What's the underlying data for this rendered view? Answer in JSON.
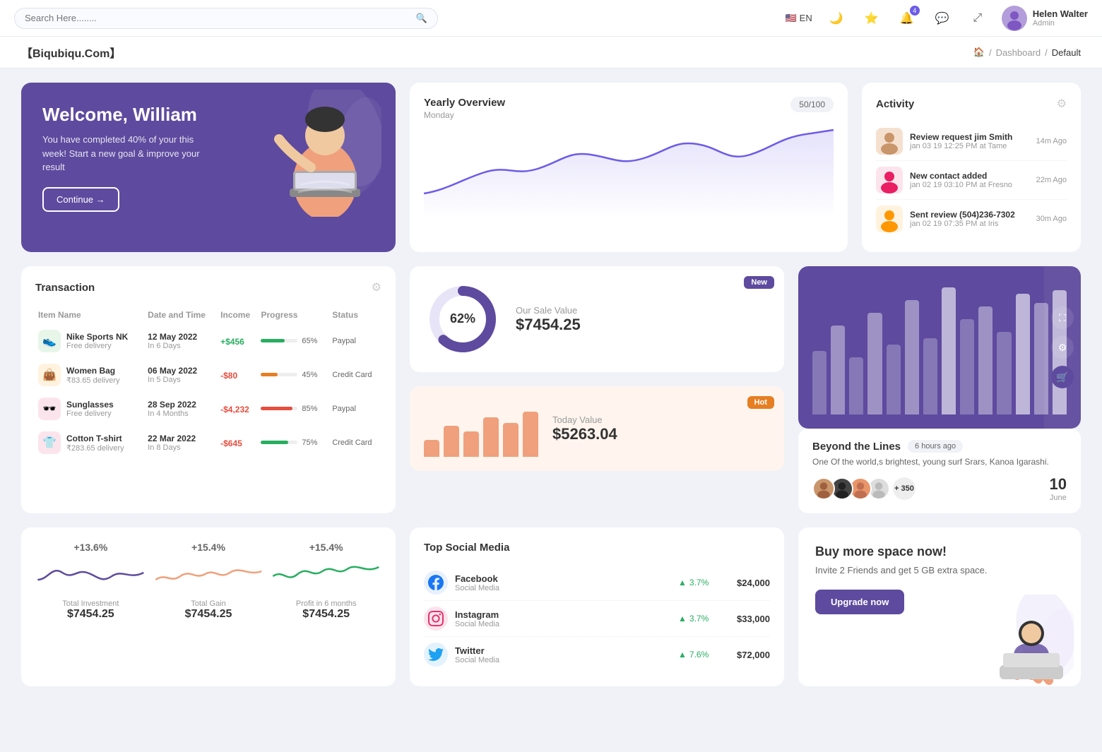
{
  "topbar": {
    "search_placeholder": "Search Here........",
    "language": "EN",
    "notification_count": "4",
    "user_name": "Helen Walter",
    "user_role": "Admin"
  },
  "breadcrumb": {
    "brand": "【Biqubiqu.Com】",
    "home": "Home",
    "dashboard": "Dashboard",
    "current": "Default"
  },
  "welcome": {
    "title": "Welcome, William",
    "subtitle": "You have completed 40% of your this week! Start a new goal & improve your result",
    "button": "Continue →"
  },
  "yearly_overview": {
    "title": "Yearly Overview",
    "subtitle": "Monday",
    "progress": "50/100"
  },
  "activity": {
    "title": "Activity",
    "items": [
      {
        "title": "Review request jim Smith",
        "time": "jan 03 19 12:25 PM at Tame",
        "ago": "14m Ago"
      },
      {
        "title": "New contact added",
        "time": "jan 02 19 03:10 PM at Fresno",
        "ago": "22m Ago"
      },
      {
        "title": "Sent review (504)236-7302",
        "time": "jan 02 19 07:35 PM at Iris",
        "ago": "30m Ago"
      }
    ]
  },
  "transaction": {
    "title": "Transaction",
    "headers": [
      "Item Name",
      "Date and Time",
      "Income",
      "Progress",
      "Status"
    ],
    "rows": [
      {
        "name": "Nike Sports NK",
        "sub": "Free delivery",
        "date": "12 May 2022",
        "days": "In 6 Days",
        "income": "+$456",
        "income_type": "pos",
        "progress": 65,
        "status": "Paypal",
        "color": "#27ae60",
        "icon": "👟",
        "icon_bg": "#e8f5e9"
      },
      {
        "name": "Women Bag",
        "sub": "₹83.65 delivery",
        "date": "06 May 2022",
        "days": "In 5 Days",
        "income": "-$80",
        "income_type": "neg",
        "progress": 45,
        "status": "Credit Card",
        "color": "#e67e22",
        "icon": "👜",
        "icon_bg": "#fff3e0"
      },
      {
        "name": "Sunglasses",
        "sub": "Free delivery",
        "date": "28 Sep 2022",
        "days": "In 4 Months",
        "income": "-$4,232",
        "income_type": "neg",
        "progress": 85,
        "status": "Paypal",
        "color": "#e74c3c",
        "icon": "🕶️",
        "icon_bg": "#fce4ec"
      },
      {
        "name": "Cotton T-shirt",
        "sub": "₹283.65 delivery",
        "date": "22 Mar 2022",
        "days": "In 8 Days",
        "income": "-$645",
        "income_type": "neg",
        "progress": 75,
        "status": "Credit Card",
        "color": "#27ae60",
        "icon": "👕",
        "icon_bg": "#fce4ec"
      }
    ]
  },
  "sale_value": {
    "label": "Our Sale Value",
    "value": "$7454.25",
    "percentage": 62,
    "badge": "New"
  },
  "today_value": {
    "label": "Today Value",
    "value": "$5263.04",
    "badge": "Hot",
    "bars": [
      30,
      55,
      45,
      70,
      60,
      80
    ]
  },
  "beyond": {
    "title": "Beyond the Lines",
    "time_ago": "6 hours ago",
    "description": "One Of the world,s brightest, young surf Srars, Kanoa Igarashi.",
    "plus_count": "+ 350",
    "date_num": "10",
    "date_month": "June"
  },
  "stats": [
    {
      "pct": "+13.6%",
      "label": "Total Investment",
      "value": "$7454.25",
      "color": "#5e4a9e"
    },
    {
      "pct": "+15.4%",
      "label": "Total Gain",
      "value": "$7454.25",
      "color": "#f0a07c"
    },
    {
      "pct": "+15.4%",
      "label": "Profit in 6 months",
      "value": "$7454.25",
      "color": "#27ae60"
    }
  ],
  "social_media": {
    "title": "Top Social Media",
    "items": [
      {
        "name": "Facebook",
        "sub": "Social Media",
        "pct": "3.7%",
        "amount": "$24,000",
        "color": "#1877f2"
      },
      {
        "name": "Instagram",
        "sub": "Social Media",
        "pct": "3.7%",
        "amount": "$33,000",
        "color": "#e1306c"
      },
      {
        "name": "Twitter",
        "sub": "Social Media",
        "pct": "7.6%",
        "amount": "$72,000",
        "color": "#1da1f2"
      }
    ]
  },
  "promo": {
    "title": "Buy more space now!",
    "sub": "Invite 2 Friends and get 5 GB extra space.",
    "button": "Upgrade now"
  }
}
